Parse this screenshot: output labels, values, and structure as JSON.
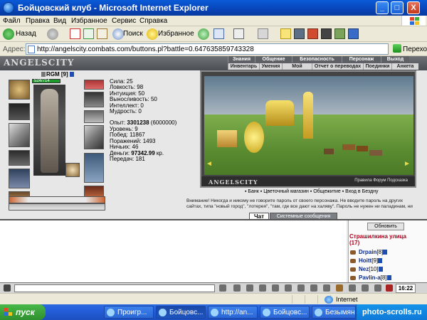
{
  "window": {
    "title": "Бойцовский клуб - Microsoft Internet Explorer",
    "min": "_",
    "max": "□",
    "close": "X"
  },
  "menu": [
    "Файл",
    "Правка",
    "Вид",
    "Избранное",
    "Сервис",
    "Справка"
  ],
  "toolbar": {
    "back": "Назад",
    "search": "Поиск",
    "favorites": "Избранное"
  },
  "address": {
    "label": "Адрес:",
    "url": "http://angelscity.combats.com/buttons.pl?battle=0.647635859743328",
    "go": "Переход"
  },
  "game": {
    "logo": "ANGELSCITY",
    "top_tabs": [
      "Знания",
      "Общение",
      "Безопасность",
      "Персонаж",
      "Выход"
    ],
    "sub_tabs": [
      "Инвентарь",
      "Умения",
      "Мой Скролл",
      "Отчет о переводах",
      "Поединки",
      "Анкета"
    ],
    "character": {
      "name": "RGM [9]",
      "hp": "524/714",
      "stats": [
        "Сила: 25",
        "Ловкость: 98",
        "Интуиция: 50",
        "Выносливость: 50",
        "Интеллект: 0",
        "Мудрость: 0"
      ],
      "info": [
        {
          "label": "Опыт: ",
          "value": "3301238",
          "extra": " (6000000)"
        },
        {
          "label": "Уровень: ",
          "value": "9",
          "extra": ""
        },
        {
          "label": "Побед: ",
          "value": "11867",
          "extra": ""
        },
        {
          "label": "Поражений: ",
          "value": "1493",
          "extra": ""
        },
        {
          "label": "Ничьих: ",
          "value": "46",
          "extra": ""
        },
        {
          "label": "Деньги: ",
          "value": "97342.99",
          "extra": " кр."
        },
        {
          "label": "Передач: ",
          "value": "181",
          "extra": ""
        }
      ]
    },
    "scene": {
      "logo": "ANGELSCITY",
      "links": "Правила   Форум   Подсказка"
    },
    "shop_links": "▪ Банк   ▪ Цветочный магазин   ▪ Общежитие   ▪ Вход в Бездну",
    "warning": "Внимание! Никогда и никому не говорите пароль от своего персонажа. Не вводите пароль на других сайтах, типа \"новый город\", \"лотерея\", \"там, где все дают на халяву\". Пароль не нужен ни паладинам, ни кланам, ни администрации, только взломщикам для кражи вашего героя.",
    "chat_tab": "Чат",
    "system_tab": "Системные сообщения",
    "refresh": "Обновить",
    "location": "Страшилкина улица",
    "count": "(17)",
    "players": [
      {
        "name": "Drpain",
        "level": "[8]"
      },
      {
        "name": "Hoitt",
        "level": "[9]"
      },
      {
        "name": "Nez",
        "level": "[10]"
      },
      {
        "name": "Pavlin-a",
        "level": "[8]"
      }
    ],
    "clock": "16:22"
  },
  "status": {
    "zone": "Internet"
  },
  "taskbar": {
    "start": "пуск",
    "tasks": [
      "Проигр...",
      "Бойцовс...",
      "http://an...",
      "Бойцовс...",
      "Безымян..."
    ],
    "tray": "photo-scrolls.ru"
  }
}
